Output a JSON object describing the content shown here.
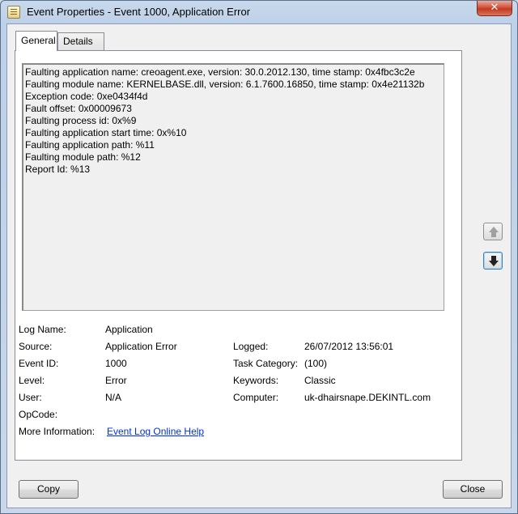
{
  "window": {
    "title": "Event Properties - Event 1000, Application Error",
    "close_glyph": "✕"
  },
  "tabs": [
    {
      "label": "General",
      "active": true
    },
    {
      "label": "Details",
      "active": false
    }
  ],
  "description": {
    "lines": [
      "Faulting application name: creoagent.exe, version: 30.0.2012.130, time stamp: 0x4fbc3c2e",
      "Faulting module name: KERNELBASE.dll, version: 6.1.7600.16850, time stamp: 0x4e21132b",
      "Exception code: 0xe0434f4d",
      "Fault offset: 0x00009673",
      "Faulting process id: 0x%9",
      "Faulting application start time: 0x%10",
      "Faulting application path: %11",
      "Faulting module path: %12",
      "Report Id: %13"
    ]
  },
  "fields": {
    "log_name": {
      "label": "Log Name:",
      "value": "Application"
    },
    "source": {
      "label": "Source:",
      "value": "Application Error"
    },
    "logged": {
      "label": "Logged:",
      "value": "26/07/2012 13:56:01"
    },
    "event_id": {
      "label": "Event ID:",
      "value": "1000"
    },
    "task_category": {
      "label": "Task Category:",
      "value": "(100)"
    },
    "level": {
      "label": "Level:",
      "value": "Error"
    },
    "keywords": {
      "label": "Keywords:",
      "value": "Classic"
    },
    "user": {
      "label": "User:",
      "value": "N/A"
    },
    "computer": {
      "label": "Computer:",
      "value": "uk-dhairsnape.DEKINTL.com"
    },
    "opcode": {
      "label": "OpCode:",
      "value": ""
    },
    "more_info": {
      "label": "More Information:",
      "value": "Event Log Online Help"
    }
  },
  "nav": {
    "up_icon": "arrow-up-icon",
    "down_icon": "arrow-down-icon"
  },
  "buttons": {
    "copy": "Copy",
    "close": "Close"
  },
  "colors": {
    "link": "#0033cc",
    "close_button": "#c23a22",
    "title_gradient": "#bcd0e8"
  }
}
